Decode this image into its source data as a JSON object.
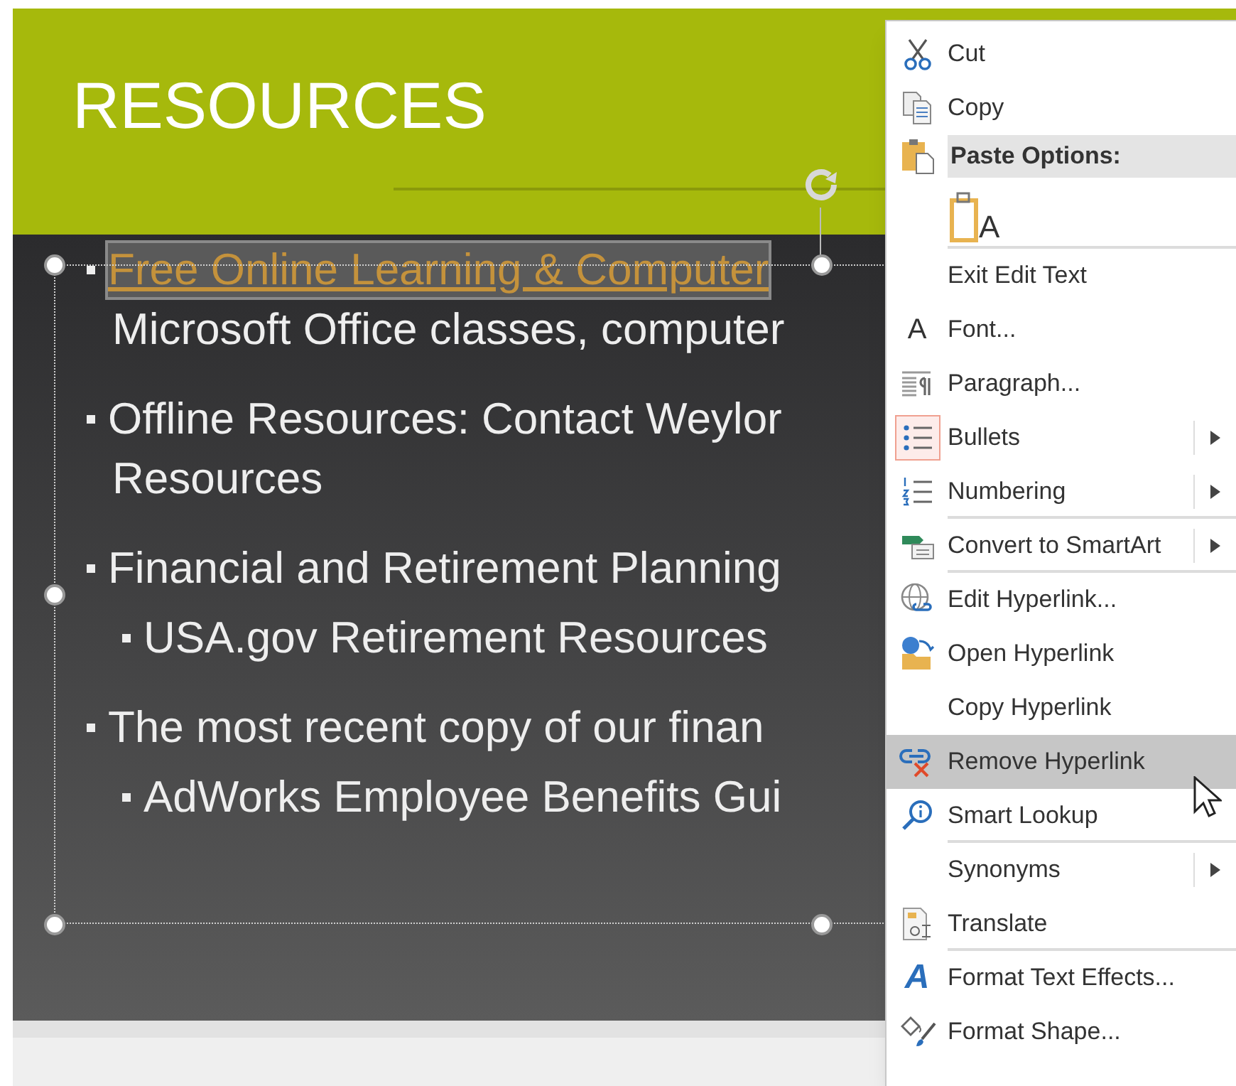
{
  "slide": {
    "title": "RESOURCES",
    "paragraphs": [
      {
        "lines": [
          {
            "kind": "link",
            "text": "Free Online Learning & Computer"
          },
          {
            "kind": "plain",
            "text": "Microsoft Office classes,  computer"
          }
        ]
      },
      {
        "lines": [
          {
            "kind": "plain",
            "text": "Offline Resources: Contact Weylor"
          },
          {
            "kind": "plain",
            "text": "Resources"
          }
        ]
      },
      {
        "lines": [
          {
            "kind": "plain",
            "text": "Financial and Retirement Planning"
          }
        ],
        "children": [
          "USA.gov Retirement Resources"
        ]
      },
      {
        "lines": [
          {
            "kind": "plain",
            "text": "The most recent copy of our finan"
          }
        ],
        "children": [
          "AdWorks Employee Benefits Gui"
        ]
      }
    ]
  },
  "context_menu": {
    "items": [
      {
        "kind": "item",
        "label": "Cut",
        "submenu": false,
        "selected": false,
        "checked": false,
        "separator_after": false
      },
      {
        "kind": "item",
        "label": "Copy",
        "submenu": false,
        "selected": false,
        "checked": false,
        "separator_after": false
      },
      {
        "kind": "header",
        "label": "Paste Options:"
      },
      {
        "kind": "paste_option",
        "glyph": "A",
        "separator_after": true
      },
      {
        "kind": "item",
        "label": "Exit Edit Text",
        "submenu": false,
        "selected": false,
        "checked": false,
        "separator_after": false
      },
      {
        "kind": "item",
        "label": "Font...",
        "glyph": "A",
        "submenu": false,
        "selected": false,
        "checked": false,
        "separator_after": false
      },
      {
        "kind": "item",
        "label": "Paragraph...",
        "submenu": false,
        "selected": false,
        "checked": false,
        "separator_after": false
      },
      {
        "kind": "item",
        "label": "Bullets",
        "submenu": true,
        "selected": false,
        "checked": true,
        "separator_after": false
      },
      {
        "kind": "item",
        "label": "Numbering",
        "submenu": true,
        "selected": false,
        "checked": false,
        "separator_after": true
      },
      {
        "kind": "item",
        "label": "Convert to SmartArt",
        "submenu": true,
        "selected": false,
        "checked": false,
        "separator_after": true
      },
      {
        "kind": "item",
        "label": "Edit Hyperlink...",
        "submenu": false,
        "selected": false,
        "checked": false,
        "separator_after": false
      },
      {
        "kind": "item",
        "label": "Open Hyperlink",
        "submenu": false,
        "selected": false,
        "checked": false,
        "separator_after": false
      },
      {
        "kind": "item",
        "label": "Copy Hyperlink",
        "submenu": false,
        "selected": false,
        "checked": false,
        "separator_after": false
      },
      {
        "kind": "item",
        "label": "Remove Hyperlink",
        "submenu": false,
        "selected": true,
        "checked": false,
        "separator_after": false
      },
      {
        "kind": "item",
        "label": "Smart Lookup",
        "submenu": false,
        "selected": false,
        "checked": false,
        "separator_after": true
      },
      {
        "kind": "item",
        "label": "Synonyms",
        "submenu": true,
        "selected": false,
        "checked": false,
        "separator_after": false
      },
      {
        "kind": "item",
        "label": "Translate",
        "submenu": false,
        "selected": false,
        "checked": false,
        "separator_after": true
      },
      {
        "kind": "item",
        "label": "Format Text Effects...",
        "glyph": "A",
        "submenu": false,
        "selected": false,
        "checked": false,
        "separator_after": false
      },
      {
        "kind": "item",
        "label": "Format Shape...",
        "submenu": false,
        "selected": false,
        "checked": false,
        "separator_after": false
      }
    ]
  }
}
